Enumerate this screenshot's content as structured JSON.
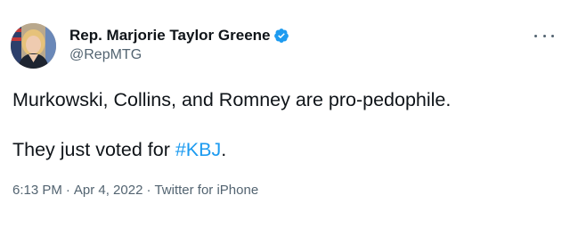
{
  "author": {
    "name": "Rep. Marjorie Taylor Greene",
    "handle": "@RepMTG"
  },
  "tweet": {
    "line1": "Murkowski, Collins, and Romney are pro-pedophile.",
    "line2_prefix": "They just voted for ",
    "hashtag": "#KBJ",
    "line2_suffix": "."
  },
  "meta": {
    "time": "6:13 PM",
    "separator": "·",
    "date": "Apr 4, 2022",
    "source": "Twitter for iPhone"
  },
  "colors": {
    "accent": "#1d9bf0",
    "text": "#0f1419",
    "secondary": "#536471"
  },
  "icons": {
    "verified": "verified-badge-icon",
    "more": "more-options-icon"
  }
}
